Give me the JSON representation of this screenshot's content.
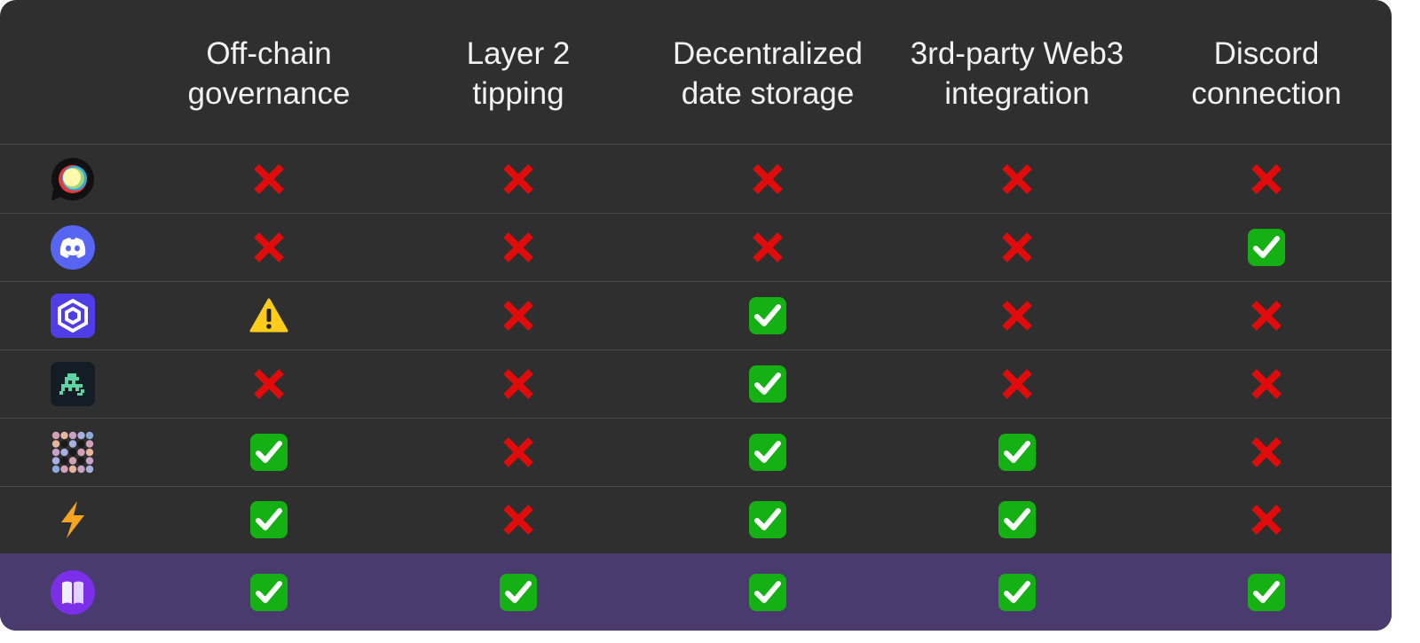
{
  "colors": {
    "card_background": "#2f2f2f",
    "divider": "#4a4a4a",
    "highlight_row": "#4a3b6e",
    "header_text": "#f2f2f2",
    "cross": "#e00b0b",
    "check": "#14b014",
    "warning": "#ffcc1a"
  },
  "columns": [
    {
      "line1": "Off-chain",
      "line2": "governance"
    },
    {
      "line1": "Layer 2",
      "line2": "tipping"
    },
    {
      "line1": "Decentralized",
      "line2": "date storage"
    },
    {
      "line1": "3rd-party Web3",
      "line2": "integration"
    },
    {
      "line1": "Discord",
      "line2": "connection"
    }
  ],
  "rows": [
    {
      "logo": "discourse-logo-icon",
      "values": [
        "no",
        "no",
        "no",
        "no",
        "no"
      ],
      "highlighted": false
    },
    {
      "logo": "discord-logo-icon",
      "values": [
        "no",
        "no",
        "no",
        "no",
        "yes"
      ],
      "highlighted": false
    },
    {
      "logo": "hexagon-logo-icon",
      "values": [
        "partial",
        "no",
        "yes",
        "no",
        "no"
      ],
      "highlighted": false
    },
    {
      "logo": "pixel-creature-logo-icon",
      "values": [
        "no",
        "no",
        "yes",
        "no",
        "no"
      ],
      "highlighted": false
    },
    {
      "logo": "dot-grid-logo-icon",
      "values": [
        "yes",
        "no",
        "yes",
        "yes",
        "no"
      ],
      "highlighted": false
    },
    {
      "logo": "lightning-bolt-icon",
      "values": [
        "yes",
        "no",
        "yes",
        "yes",
        "no"
      ],
      "highlighted": false
    },
    {
      "logo": "purple-book-logo-icon",
      "values": [
        "yes",
        "yes",
        "yes",
        "yes",
        "yes"
      ],
      "highlighted": true
    }
  ]
}
